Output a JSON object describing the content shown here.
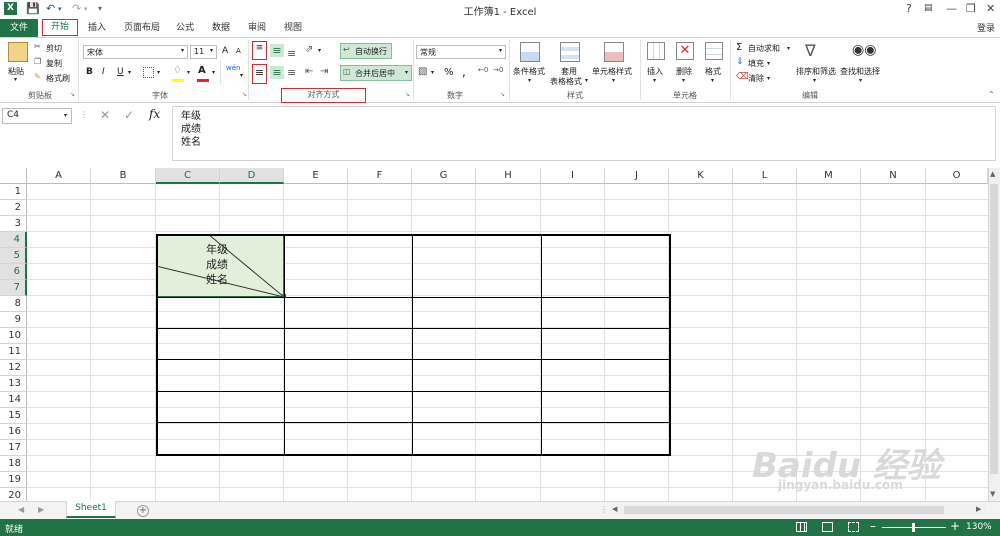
{
  "window": {
    "title": "工作簿1 - Excel",
    "help": "?",
    "login": "登录"
  },
  "tabs": [
    "文件",
    "开始",
    "插入",
    "页面布局",
    "公式",
    "数据",
    "审阅",
    "视图"
  ],
  "ribbon": {
    "clipboard": {
      "paste": "粘贴",
      "cut": "剪切",
      "copy": "复制",
      "format_painter": "格式刷",
      "label": "剪贴板"
    },
    "font": {
      "name": "宋体",
      "size": "11",
      "grow": "A",
      "shrink": "A",
      "bold": "B",
      "italic": "I",
      "underline": "U",
      "label": "字体"
    },
    "alignment": {
      "wrap": "自动换行",
      "merge": "合并后居中",
      "label": "对齐方式"
    },
    "number": {
      "format": "常规",
      "percent": "%",
      "comma": ",",
      "label": "数字"
    },
    "styles": {
      "conditional": "条件格式",
      "table_line1": "套用",
      "table_line2": "表格格式",
      "cell_styles": "单元格样式",
      "label": "样式"
    },
    "cells": {
      "insert": "插入",
      "delete": "删除",
      "format": "格式",
      "label": "单元格"
    },
    "editing": {
      "autosum": "自动求和",
      "fill": "填充",
      "clear": "清除",
      "sort": "排序和筛选",
      "find": "查找和选择",
      "label": "编辑"
    }
  },
  "formula_bar": {
    "name_box": "C4",
    "fx": "fx",
    "content": [
      "年级",
      "成绩",
      "姓名"
    ]
  },
  "grid": {
    "columns": [
      "A",
      "B",
      "C",
      "D",
      "E",
      "F",
      "G",
      "H",
      "I",
      "J",
      "K",
      "L",
      "M",
      "N",
      "O"
    ],
    "rows": [
      "1",
      "2",
      "3",
      "4",
      "5",
      "6",
      "7",
      "8",
      "9",
      "10",
      "11",
      "12",
      "13",
      "14",
      "15",
      "16",
      "17",
      "18",
      "19",
      "20"
    ],
    "cell_c4": [
      "年级",
      "成绩",
      "姓名"
    ]
  },
  "sheet_tabs": [
    "Sheet1"
  ],
  "status": {
    "mode": "就绪",
    "zoom": "130%"
  },
  "watermark": {
    "brand": "Baidu 经验",
    "url": "jingyan.baidu.com"
  },
  "colors": {
    "excel_green": "#217346",
    "selected_fill": "#e2efda",
    "red_highlight": "#e0262b"
  }
}
